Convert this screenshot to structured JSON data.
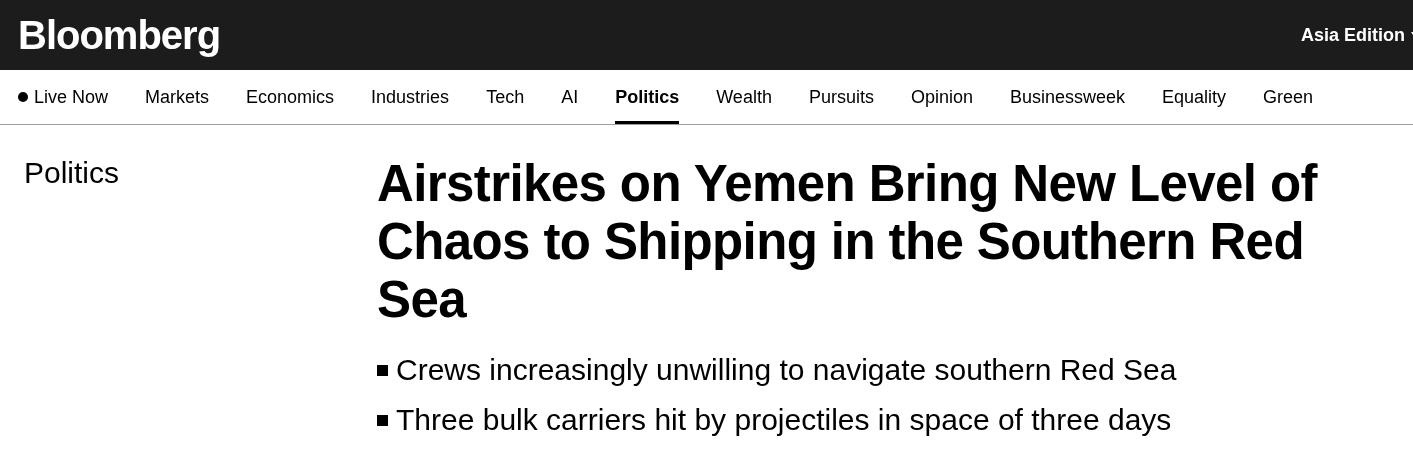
{
  "header": {
    "logo": "Bloomberg",
    "edition": "Asia Edition"
  },
  "nav": [
    {
      "label": "Live Now",
      "kind": "live",
      "selected": false
    },
    {
      "label": "Markets",
      "kind": "link",
      "selected": false
    },
    {
      "label": "Economics",
      "kind": "link",
      "selected": false
    },
    {
      "label": "Industries",
      "kind": "link",
      "selected": false
    },
    {
      "label": "Tech",
      "kind": "link",
      "selected": false
    },
    {
      "label": "AI",
      "kind": "link",
      "selected": false
    },
    {
      "label": "Politics",
      "kind": "link",
      "selected": true
    },
    {
      "label": "Wealth",
      "kind": "link",
      "selected": false
    },
    {
      "label": "Pursuits",
      "kind": "link",
      "selected": false
    },
    {
      "label": "Opinion",
      "kind": "link",
      "selected": false
    },
    {
      "label": "Businessweek",
      "kind": "link",
      "selected": false
    },
    {
      "label": "Equality",
      "kind": "link",
      "selected": false
    },
    {
      "label": "Green",
      "kind": "link",
      "selected": false
    }
  ],
  "article": {
    "section": "Politics",
    "headline": "Airstrikes on Yemen Bring New Level of Chaos to Shipping in the Southern Red Sea",
    "bullets": [
      "Crews increasingly unwilling to navigate southern Red Sea",
      "Three bulk carriers hit by projectiles in space of three days"
    ]
  }
}
